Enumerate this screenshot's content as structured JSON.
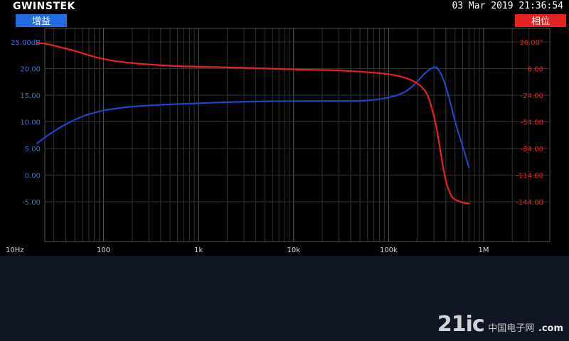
{
  "header": {
    "brand": "GWINSTEK",
    "datetime": "03 Mar 2019 21:36:54"
  },
  "watermark": {
    "main": "21ic",
    "sub": "中国电子网",
    "domain": ".com"
  },
  "colors": {
    "gain": "#1f45c8",
    "phase": "#e52222",
    "background": "#000000",
    "grid": "#3c3c3c"
  },
  "chart_data": {
    "type": "line",
    "xscale": "log",
    "xlim": [
      10,
      1000000
    ],
    "x_tick_labels": [
      {
        "value": 10,
        "label": "10Hz"
      },
      {
        "value": 100,
        "label": "100"
      },
      {
        "value": 1000,
        "label": "1k"
      },
      {
        "value": 10000,
        "label": "10k"
      },
      {
        "value": 100000,
        "label": "100k"
      },
      {
        "value": 1000000,
        "label": "1M"
      }
    ],
    "left_axis": {
      "label": "增益",
      "ylim": [
        -15,
        25
      ],
      "ticks": [
        {
          "value": 25,
          "label": "25.00dB"
        },
        {
          "value": 20,
          "label": "20.00"
        },
        {
          "value": 15,
          "label": "15.00"
        },
        {
          "value": 10,
          "label": "10.00"
        },
        {
          "value": 5,
          "label": "5.00"
        },
        {
          "value": 0,
          "label": "0.00"
        },
        {
          "value": -5,
          "label": "-5.00"
        }
      ]
    },
    "right_axis": {
      "label": "相位",
      "ylim": [
        -204,
        36
      ],
      "ticks": [
        {
          "value": 36,
          "label": "36.00°"
        },
        {
          "value": 6,
          "label": "6.00"
        },
        {
          "value": -24,
          "label": "-24.00"
        },
        {
          "value": -54,
          "label": "-54.00"
        },
        {
          "value": -84,
          "label": "-84.00"
        },
        {
          "value": -114,
          "label": "-114.00"
        },
        {
          "value": -144,
          "label": "-144.00"
        }
      ]
    },
    "grid": true,
    "series": [
      {
        "name": "增益",
        "axis": "left",
        "x": [
          20,
          30,
          50,
          80,
          120,
          200,
          400,
          1000,
          3000,
          10000,
          30000,
          60000,
          100000,
          150000,
          200000,
          250000,
          300000,
          330000,
          400000,
          500000,
          600000,
          700000
        ],
        "y": [
          6,
          8.3,
          10.5,
          11.8,
          12.4,
          12.9,
          13.2,
          13.5,
          13.8,
          13.9,
          13.9,
          13.95,
          14.5,
          15.5,
          17.5,
          19.5,
          20.3,
          20.2,
          17,
          10,
          5.5,
          1.5
        ]
      },
      {
        "name": "相位",
        "axis": "right",
        "x": [
          20,
          25,
          35,
          50,
          80,
          120,
          200,
          500,
          1000,
          3000,
          10000,
          30000,
          60000,
          100000,
          150000,
          200000,
          250000,
          280000,
          320000,
          360000,
          400000,
          450000,
          500000,
          600000,
          700000
        ],
        "y": [
          35,
          34,
          30,
          26,
          19,
          15,
          12,
          9,
          8,
          7,
          5,
          4,
          2,
          0,
          -4,
          -10,
          -20,
          -35,
          -60,
          -95,
          -122,
          -137,
          -142,
          -145,
          -146
        ]
      }
    ]
  }
}
